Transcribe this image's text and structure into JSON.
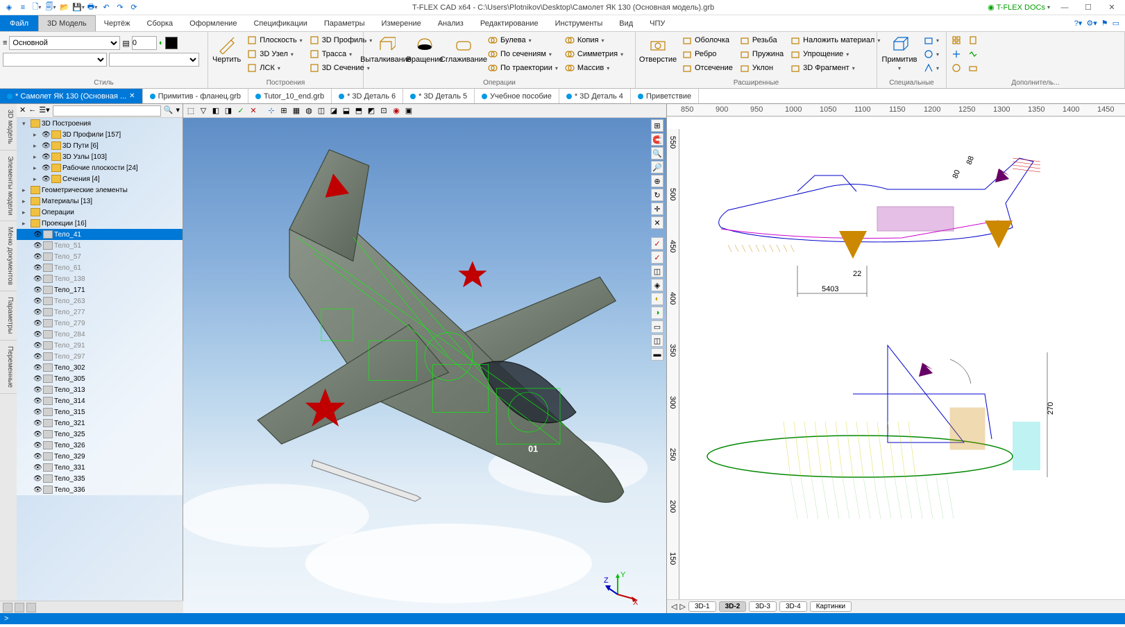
{
  "title": "T-FLEX CAD x64 - C:\\Users\\Plotnikov\\Desktop\\Самолет ЯК 130 (Основная модель).grb",
  "docs_label": "T-FLEX DOCs",
  "menu": {
    "file": "Файл",
    "items": [
      "3D Модель",
      "Чертёж",
      "Сборка",
      "Оформление",
      "Спецификации",
      "Параметры",
      "Измерение",
      "Анализ",
      "Редактирование",
      "Инструменты",
      "Вид",
      "ЧПУ"
    ],
    "active": 0
  },
  "style": {
    "combo": "Основной",
    "weight": "0",
    "label": "Стиль"
  },
  "ribbon": {
    "draw": {
      "btn": "Чертить",
      "group": "Построения",
      "items": [
        "Плоскость",
        "3D Узел",
        "ЛСК",
        "3D Профиль",
        "Трасса",
        "3D Сечение"
      ]
    },
    "ops": {
      "group": "Операции",
      "big": [
        "Выталкивание",
        "Вращение",
        "Сглаживание"
      ],
      "small": [
        "Булева",
        "По сечениям",
        "По траектории",
        "Копия",
        "Симметрия",
        "Массив"
      ]
    },
    "hole": {
      "btn": "Отверстие",
      "group": "Расширенные",
      "small": [
        "Оболочка",
        "Ребро",
        "Отсечение",
        "Резьба",
        "Пружина",
        "Уклон",
        "Наложить материал",
        "Упрощение",
        "3D Фрагмент"
      ]
    },
    "prim": {
      "btn": "Примитив",
      "group": "Специальные"
    },
    "extra": {
      "group": "Дополнитель..."
    }
  },
  "doc_tabs": [
    {
      "label": "* Самолет ЯК 130 (Основная ...",
      "active": true,
      "close": true
    },
    {
      "label": "Примитив - фланец.grb"
    },
    {
      "label": "Tutor_10_end.grb"
    },
    {
      "label": "* 3D Деталь 6"
    },
    {
      "label": "* 3D Деталь 5"
    },
    {
      "label": "Учебное пособие"
    },
    {
      "label": "* 3D Деталь 4"
    },
    {
      "label": "Приветствие"
    }
  ],
  "side_tabs": [
    "3D модель",
    "Элементы модели",
    "Меню документов",
    "Параметры",
    "Переменные"
  ],
  "tree": {
    "root": "3D Построения",
    "groups": [
      {
        "label": "3D Профили [157]"
      },
      {
        "label": "3D Пути [6]"
      },
      {
        "label": "3D Узлы [103]"
      },
      {
        "label": "Рабочие плоскости [24]"
      },
      {
        "label": "Сечения [4]"
      }
    ],
    "mid": [
      {
        "label": "Геометрические элементы"
      },
      {
        "label": "Материалы [13]"
      },
      {
        "label": "Операции"
      },
      {
        "label": "Проекции [16]"
      }
    ],
    "bodies": [
      {
        "l": "Тело_41",
        "sel": true
      },
      {
        "l": "Тело_51",
        "dim": true
      },
      {
        "l": "Тело_57",
        "dim": true
      },
      {
        "l": "Тело_61",
        "dim": true
      },
      {
        "l": "Тело_138",
        "dim": true
      },
      {
        "l": "Тело_171"
      },
      {
        "l": "Тело_263",
        "dim": true
      },
      {
        "l": "Тело_277",
        "dim": true
      },
      {
        "l": "Тело_279",
        "dim": true
      },
      {
        "l": "Тело_284",
        "dim": true
      },
      {
        "l": "Тело_291",
        "dim": true
      },
      {
        "l": "Тело_297",
        "dim": true
      },
      {
        "l": "Тело_302"
      },
      {
        "l": "Тело_305"
      },
      {
        "l": "Тело_313"
      },
      {
        "l": "Тело_314"
      },
      {
        "l": "Тело_315"
      },
      {
        "l": "Тело_321"
      },
      {
        "l": "Тело_325"
      },
      {
        "l": "Тело_326"
      },
      {
        "l": "Тело_329"
      },
      {
        "l": "Тело_331"
      },
      {
        "l": "Тело_335"
      },
      {
        "l": "Тело_336"
      }
    ]
  },
  "ruler_h": [
    "850",
    "900",
    "950",
    "1000",
    "1050",
    "1100",
    "1150",
    "1200",
    "1250",
    "1300",
    "1350",
    "1400",
    "1450"
  ],
  "ruler_v": [
    "550",
    "500",
    "450",
    "400",
    "350",
    "300",
    "250",
    "200",
    "150"
  ],
  "vp2d_tabs": [
    "3D-1",
    "3D-2",
    "3D-3",
    "3D-4",
    "Картинки"
  ],
  "vp2d_active": 1,
  "dims": {
    "a": "5403",
    "b": "22",
    "c": "88",
    "d": "80",
    "e": "270"
  },
  "status": ">"
}
